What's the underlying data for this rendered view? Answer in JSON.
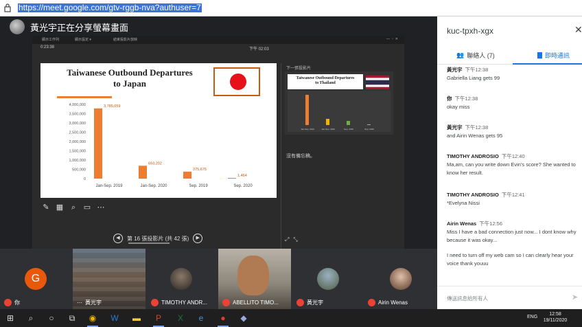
{
  "browser": {
    "url": "https://meet.google.com/gtv-rggb-nva?authuser=7"
  },
  "presenter_banner": {
    "text": "黃光宇正在分享螢幕畫面"
  },
  "slideshow": {
    "toolbar_items": [
      "顯示工作列",
      "顯示設定 ▾",
      "結束投影片放映"
    ],
    "elapsed": "0:23:38",
    "clock": "下午 02:03",
    "next_label": "下一張投影片",
    "notes": "沒有備忘稿。",
    "slide_counter": "第 16 張投影片 (共 42 張)",
    "current_slide": {
      "title_line1": "Taiwanese Outbound Departures",
      "title_line2": "to Japan"
    },
    "next_slide": {
      "title_line1": "Taiwanese Outbound Departures",
      "title_line2": "to Thailand",
      "labels": [
        "Jan-Sep. 2019",
        "Jan-Sep. 2020",
        "Sep. 2019",
        "Sep. 2020"
      ]
    }
  },
  "chart_data": {
    "type": "bar",
    "title": "Taiwanese Outbound Departures to Japan",
    "categories": [
      "Jan-Sep. 2019",
      "Jan-Sep. 2020",
      "Sep. 2019",
      "Sep. 2020"
    ],
    "values": [
      3785059,
      693202,
      375675,
      1464
    ],
    "value_labels": [
      "3,785,059",
      "693,202",
      "375,675",
      "1,464"
    ],
    "y_ticks": [
      "4,000,000",
      "3,500,000",
      "3,000,000",
      "2,500,000",
      "2,000,000",
      "1,500,000",
      "1,000,000",
      "500,000",
      "0"
    ],
    "ylim": [
      0,
      4000000
    ],
    "color": "#ed7d31"
  },
  "chat_panel": {
    "meeting_code": "kuc-tpxh-xgx",
    "people_tab": "聯絡人 (7)",
    "chat_tab": "即時通訊",
    "input_placeholder": "傳送訊息給所有人",
    "messages": [
      {
        "author": "黃光宇",
        "time": "下午12:38",
        "text": "Gabriella Liang gets 99"
      },
      {
        "author": "你",
        "time": "下午12:38",
        "text": "okay miss"
      },
      {
        "author": "黃光宇",
        "time": "下午12:38",
        "text": "and Airin Wenas gets 95"
      },
      {
        "author": "TIMOTHY ANDROSIO",
        "time": "下午12:40",
        "text": "Ma,am, can you write down Evin's score? She wanted to know her result."
      },
      {
        "author": "TIMOTHY ANDROSIO",
        "time": "下午12:41",
        "text": "*Evelyna Nissi"
      },
      {
        "author": "Airin Wenas",
        "time": "下午12:56",
        "text": "Miss I have a bad connection just now... I dont know why because it was okay..."
      },
      {
        "author": "",
        "time": "",
        "text": "I need to turn off my web cam so I can clearly hear your voice thank youuu"
      }
    ]
  },
  "participants": [
    {
      "name": "你",
      "initial": "G"
    },
    {
      "name": "黃光宇"
    },
    {
      "name": "TIMOTHY ANDR..."
    },
    {
      "name": "ABELLITO TIMO..."
    },
    {
      "name": "黃光宇"
    },
    {
      "name": "Airin Wenas"
    }
  ],
  "taskbar": {
    "language": "ENG",
    "time": "12:58",
    "date": "19/11/2020"
  },
  "colors": {
    "accent": "#1a73e8",
    "mic_off": "#ea4335",
    "avatar_g": "#e8590c",
    "bar": "#ed7d31"
  }
}
